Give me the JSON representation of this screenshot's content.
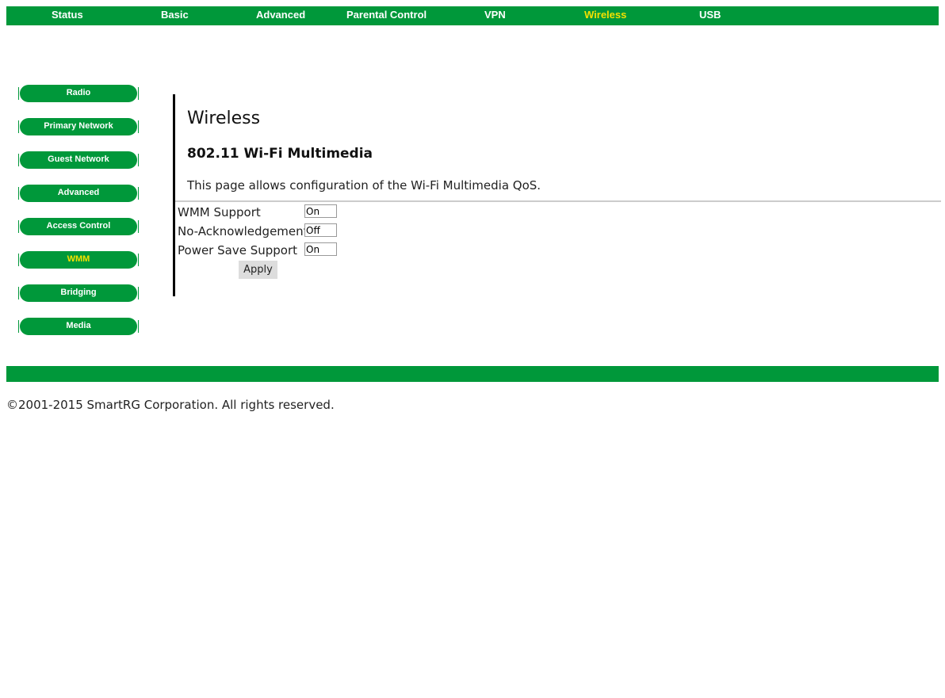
{
  "topnav": [
    {
      "label": "Status",
      "active": false
    },
    {
      "label": "Basic",
      "active": false
    },
    {
      "label": "Advanced",
      "active": false
    },
    {
      "label": "Parental Control",
      "active": false
    },
    {
      "label": "VPN",
      "active": false
    },
    {
      "label": "Wireless",
      "active": true
    },
    {
      "label": "USB",
      "active": false
    }
  ],
  "sidebar": [
    {
      "label": "Radio"
    },
    {
      "label": "Primary Network"
    },
    {
      "label": "Guest Network"
    },
    {
      "label": "Advanced"
    },
    {
      "label": "Access Control"
    },
    {
      "label": "WMM",
      "active": true
    },
    {
      "label": "Bridging"
    },
    {
      "label": "Media"
    }
  ],
  "page": {
    "title": "Wireless",
    "subtitle": "802.11 Wi-Fi Multimedia",
    "description": "This page allows configuration of the Wi-Fi Multimedia QoS.",
    "fields": [
      {
        "label": "WMM Support",
        "value": "On"
      },
      {
        "label": "No-Acknowledgement",
        "value": "Off"
      },
      {
        "label": "Power Save Support",
        "value": "On"
      }
    ],
    "apply_label": "Apply"
  },
  "footer": {
    "copyright": "©2001-2015 SmartRG Corporation. All rights reserved."
  },
  "colors": {
    "brand_green": "#00983a",
    "active_yellow": "#f5e100"
  }
}
